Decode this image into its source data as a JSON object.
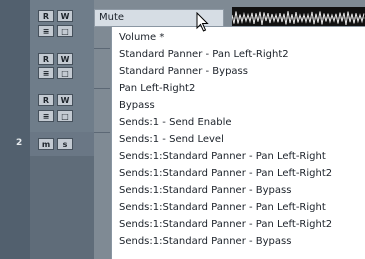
{
  "tracks": [
    {
      "r": "R",
      "w": "W",
      "number": ""
    },
    {
      "r": "R",
      "w": "W",
      "number": ""
    },
    {
      "r": "R",
      "w": "W",
      "number": ""
    },
    {
      "r": "m",
      "w": "s",
      "number": "2"
    }
  ],
  "automation": {
    "parameter": "Mute"
  },
  "menu": {
    "items": [
      "Volume *",
      "Standard Panner - Pan Left-Right2",
      "Standard Panner - Bypass",
      "Pan Left-Right2",
      "Bypass",
      "Sends:1 - Send Enable",
      "Sends:1 - Send Level",
      "Sends:1:Standard Panner - Pan Left-Right",
      "Sends:1:Standard Panner - Pan Left-Right2",
      "Sends:1:Standard Panner - Bypass",
      "Sends:1:Standard Panner - Pan Left-Right",
      "Sends:1:Standard Panner - Pan Left-Right2",
      "Sends:1:Standard Panner - Bypass"
    ]
  }
}
